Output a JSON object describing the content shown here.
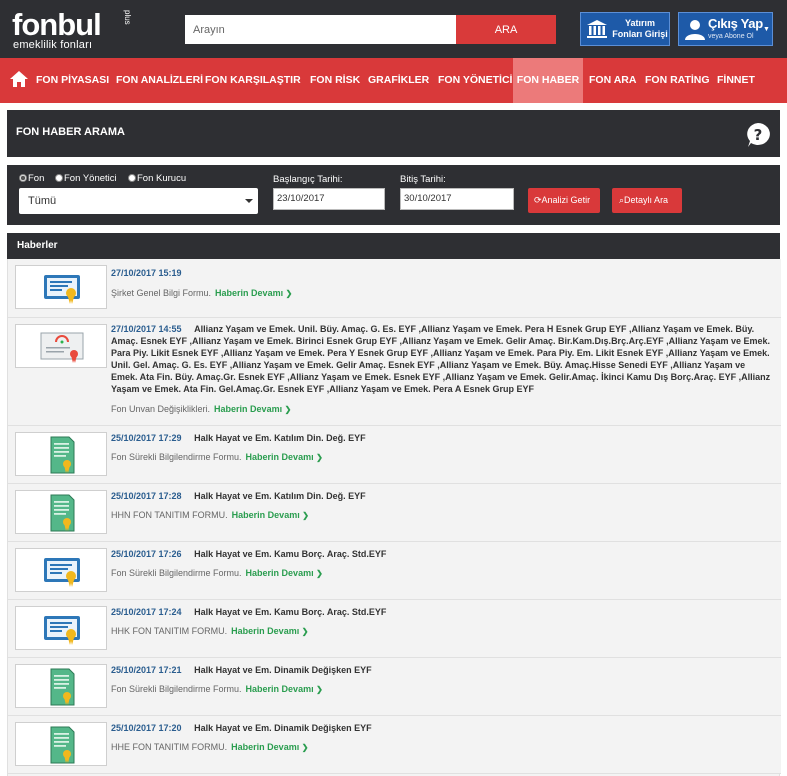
{
  "header": {
    "logo_main": "fonbul",
    "logo_plus": "plus",
    "logo_sub": "emeklilik fonları",
    "search_placeholder": "Arayın",
    "search_button": "ARA",
    "invest_button": "Yatırım Fonları Girişi",
    "user_title": "Çıkış Yap",
    "user_sub": "veya Abone Ol"
  },
  "nav": {
    "items": [
      "FON PİYASASI",
      "FON ANALİZLERİ",
      "FON KARŞILAŞTIR",
      "FON RİSK",
      "GRAFİKLER",
      "FON YÖNETİCİ",
      "FON HABER",
      "FON ARA",
      "FON RATİNG",
      "FİNNET"
    ],
    "active": "FON HABER"
  },
  "panel": {
    "title": "FON HABER ARAMA"
  },
  "filter": {
    "radios": [
      "Fon",
      "Fon Yönetici",
      "Fon Kurucu"
    ],
    "selected_radio": "Fon",
    "select_value": "Tümü",
    "start_label": "Başlangıç Tarihi:",
    "start_value": "23/10/2017",
    "end_label": "Bitiş Tarihi:",
    "end_value": "30/10/2017",
    "analyze_button": "Analizi Getir",
    "detail_button": "Detaylı Ara"
  },
  "news": {
    "header": "Haberler",
    "more_label": "Haberin Devamı",
    "items": [
      {
        "icon": "certificate-blue-icon",
        "date": "27/10/2017 15:19",
        "title": "",
        "desc": "Şirket Genel Bilgi Formu."
      },
      {
        "icon": "diploma-icon",
        "date": "27/10/2017 14:55",
        "title": "Allianz Yaşam ve Emek. Unil. Büy. Amaç. G. Es. EYF ,Allianz Yaşam ve Emek. Pera H Esnek Grup EYF ,Allianz Yaşam ve Emek. Büy. Amaç. Esnek EYF ,Allianz Yaşam ve Emek. Birinci Esnek Grup EYF ,Allianz Yaşam ve Emek. Gelir Amaç. Bir.Kam.Dış.Brç.Arç.EYF ,Allianz Yaşam ve Emek. Para Piy. Likit Esnek EYF ,Allianz Yaşam ve Emek. Pera Y Esnek Grup EYF ,Allianz Yaşam ve Emek. Para Piy. Em. Likit Esnek EYF ,Allianz Yaşam ve Emek. Unil. Gel. Amaç. G. Es. EYF ,Allianz Yaşam ve Emek. Gelir Amaç. Esnek EYF ,Allianz Yaşam ve Emek. Büy. Amaç.Hisse Senedi EYF ,Allianz Yaşam ve Emek. Ata Fin. Büy. Amaç.Gr. Esnek EYF ,Allianz Yaşam ve Emek. Esnek EYF ,Allianz Yaşam ve Emek. Gelir.Amaç. İkinci Kamu Dış Borç.Araç. EYF ,Allianz Yaşam ve Emek. Ata Fin. Gel.Amaç.Gr. Esnek EYF ,Allianz Yaşam ve Emek. Pera A Esnek Grup EYF",
        "desc": "Fon Unvan Değişiklikleri."
      },
      {
        "icon": "document-green-icon",
        "date": "25/10/2017 17:29",
        "title": "Halk Hayat ve Em. Katılım Din. Değ. EYF",
        "desc": "Fon Sürekli Bilgilendirme Formu."
      },
      {
        "icon": "document-green-icon",
        "date": "25/10/2017 17:28",
        "title": "Halk Hayat ve Em. Katılım Din. Değ. EYF",
        "desc": "HHN FON TANITIM FORMU."
      },
      {
        "icon": "certificate-blue-icon",
        "date": "25/10/2017 17:26",
        "title": "Halk Hayat ve Em. Kamu Borç. Araç. Std.EYF",
        "desc": "Fon Sürekli Bilgilendirme Formu."
      },
      {
        "icon": "certificate-blue-icon",
        "date": "25/10/2017 17:24",
        "title": "Halk Hayat ve Em. Kamu Borç. Araç. Std.EYF",
        "desc": "HHK FON TANITIM FORMU."
      },
      {
        "icon": "document-green-icon",
        "date": "25/10/2017 17:21",
        "title": "Halk Hayat ve Em. Dinamik Değişken EYF",
        "desc": "Fon Sürekli Bilgilendirme Formu."
      },
      {
        "icon": "document-green-icon",
        "date": "25/10/2017 17:20",
        "title": "Halk Hayat ve Em. Dinamik Değişken EYF",
        "desc": "HHE FON TANITIM FORMU."
      }
    ]
  },
  "colors": {
    "dark": "#2e2f33",
    "brand_red": "#d9393a",
    "active_tab": "#ec7a7a",
    "blue_button": "#1e5aa8",
    "date_blue": "#2a5d8f",
    "link_green": "#2a9d4f"
  }
}
